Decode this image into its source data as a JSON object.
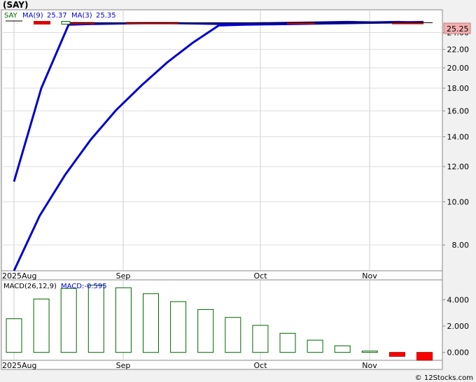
{
  "title": "(SAY)",
  "credit": "© 12Stocks.com",
  "legend": {
    "symbol": "SAY",
    "ma9_label": "MA(9)",
    "ma9_value": "25.37",
    "ma3_label": "MA(3)",
    "ma3_value": "25.35"
  },
  "macd_legend": {
    "label": "MACD(26,12,9)",
    "value": "MACD:-0.595"
  },
  "colors": {
    "ma9": "#0000cc",
    "ma3": "#dd0000",
    "price_line": "#000000",
    "up": "#006600",
    "down": "#ff0000",
    "last_badge": "#f4b0b0"
  },
  "chart_data": [
    {
      "type": "line",
      "scale": "log",
      "ylim": [
        7.0,
        27.0
      ],
      "yticks": [
        "8.00",
        "10.00",
        "12.00",
        "14.00",
        "16.00",
        "18.00",
        "20.00",
        "22.00",
        "24.00"
      ],
      "yticks_values": [
        8,
        10,
        12,
        14,
        16,
        18,
        20,
        22,
        24
      ],
      "xticks": [
        "2025Aug",
        "Sep",
        "Oct",
        "Nov"
      ],
      "last_price_label": "25.25",
      "series": [
        {
          "name": "MA(9)",
          "color": "#0000cc",
          "values": [
            7.0,
            9.3,
            11.5,
            13.8,
            16.1,
            18.3,
            20.6,
            22.8,
            24.9,
            25.0,
            25.05,
            25.1,
            25.15,
            25.2,
            25.25,
            25.3,
            25.35
          ]
        },
        {
          "name": "MA(3)",
          "color": "#0000cc",
          "values": [
            11.1,
            18.0,
            25.0,
            25.1,
            25.15,
            25.2,
            25.2,
            25.15,
            25.1,
            25.15,
            25.2,
            25.25,
            25.3,
            25.35,
            25.3,
            25.35,
            25.25
          ]
        }
      ]
    },
    {
      "type": "bar",
      "ylim": [
        -0.6,
        5.5
      ],
      "yticks": [
        "0.000",
        "2.000",
        "4.000"
      ],
      "yticks_values": [
        0,
        2,
        4
      ],
      "xticks": [
        "2025Aug",
        "Sep",
        "Oct",
        "Nov"
      ],
      "values": [
        2.55,
        4.05,
        4.85,
        5.1,
        4.9,
        4.45,
        3.85,
        3.25,
        2.65,
        2.05,
        1.45,
        0.93,
        0.5,
        0.1,
        -0.3,
        -0.595
      ]
    }
  ]
}
